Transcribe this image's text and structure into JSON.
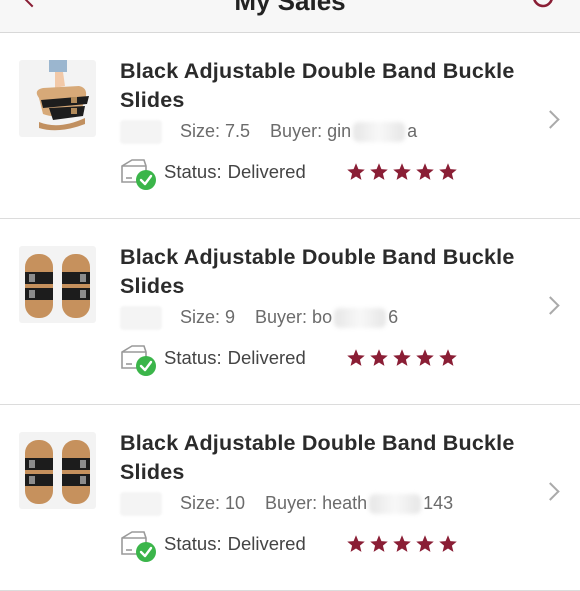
{
  "header": {
    "title": "My Sales"
  },
  "colors": {
    "accent": "#8a1e35",
    "delivered_green": "#3bb54a",
    "star": "#8a1e35"
  },
  "sales": [
    {
      "product": "Black Adjustable Double Band Buckle Slides",
      "size": "Size: 7.5",
      "buyer_prefix": "Buyer: gin",
      "buyer_suffix": "a",
      "status_key": "Status:",
      "status_value": "Delivered",
      "rating": 5
    },
    {
      "product": "Black Adjustable Double Band Buckle Slides",
      "size": "Size: 9",
      "buyer_prefix": "Buyer: bo",
      "buyer_suffix": "6",
      "status_key": "Status:",
      "status_value": "Delivered",
      "rating": 5
    },
    {
      "product": "Black Adjustable Double Band Buckle Slides",
      "size": "Size: 10",
      "buyer_prefix": "Buyer: heath",
      "buyer_suffix": "143",
      "status_key": "Status:",
      "status_value": "Delivered",
      "rating": 5
    }
  ],
  "icons": {
    "back": "chevron-left-icon",
    "refresh": "refresh-icon",
    "row": "chevron-right-icon",
    "status": "package-delivered-icon",
    "star": "star-icon"
  }
}
